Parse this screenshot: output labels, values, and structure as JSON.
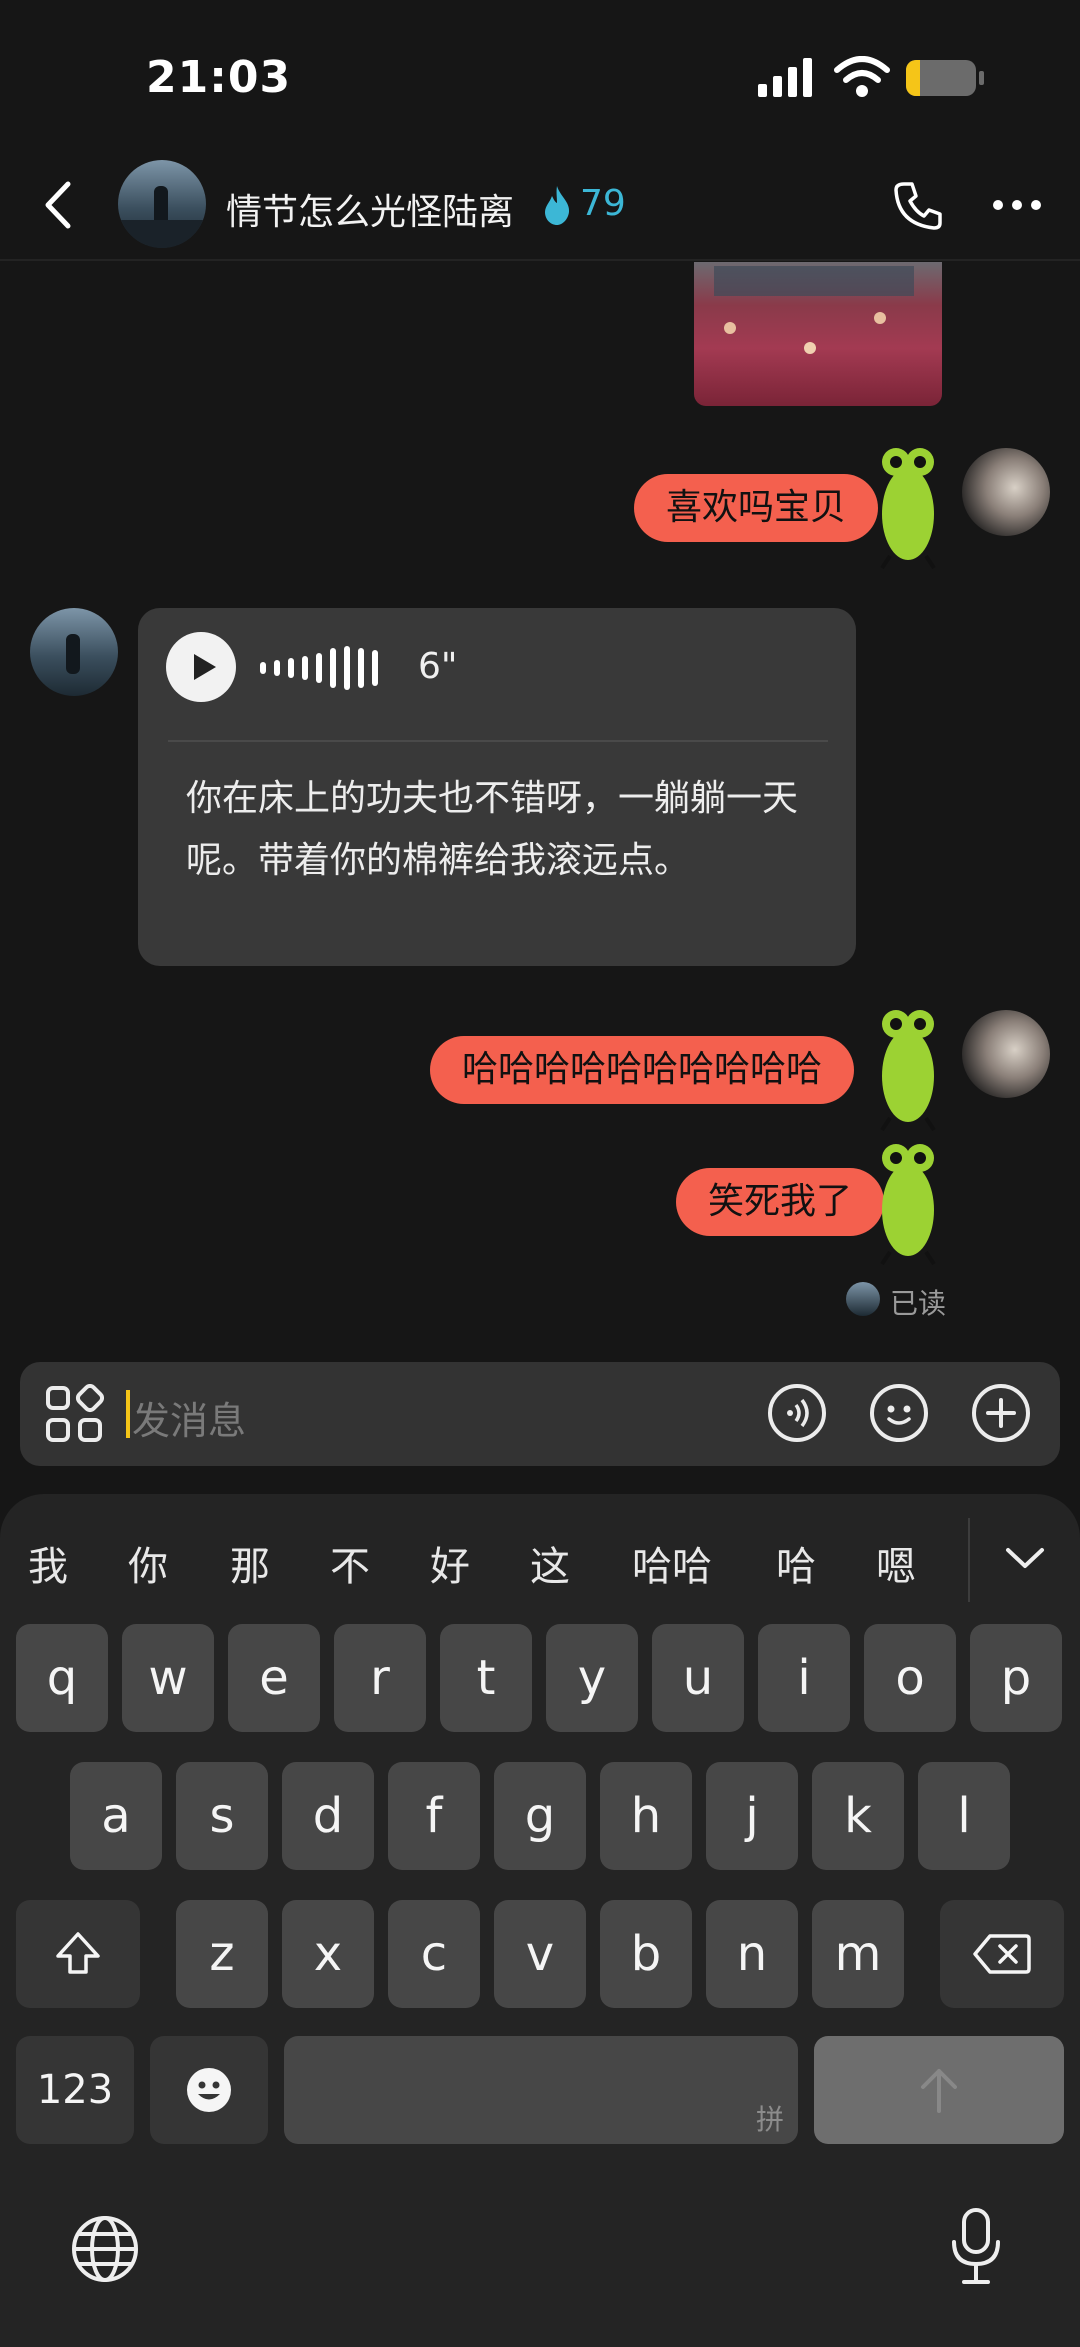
{
  "status_bar": {
    "time": "21:03"
  },
  "header": {
    "title": "情节怎么光怪陆离",
    "score": "79"
  },
  "messages": {
    "m1": "喜欢吗宝贝",
    "voice": {
      "duration": "6\"",
      "transcript": "你在床上的功夫也不错呀，一躺躺一天呢。带着你的棉裤给我滚远点。"
    },
    "m2": "哈哈哈哈哈哈哈哈哈哈",
    "m3": "笑死我了",
    "read_receipt": "已读"
  },
  "input": {
    "placeholder": "发消息"
  },
  "keyboard": {
    "candidates": [
      "我",
      "你",
      "那",
      "不",
      "好",
      "这",
      "哈哈",
      "哈",
      "嗯"
    ],
    "row1": [
      "q",
      "w",
      "e",
      "r",
      "t",
      "y",
      "u",
      "i",
      "o",
      "p"
    ],
    "row2": [
      "a",
      "s",
      "d",
      "f",
      "g",
      "h",
      "j",
      "k",
      "l"
    ],
    "row3": [
      "z",
      "x",
      "c",
      "v",
      "b",
      "n",
      "m"
    ],
    "numbers_key": "123",
    "space_hint": "拼"
  },
  "colors": {
    "accent": "#f4604e",
    "score": "#3cb7d6",
    "caret": "#f5c518"
  }
}
